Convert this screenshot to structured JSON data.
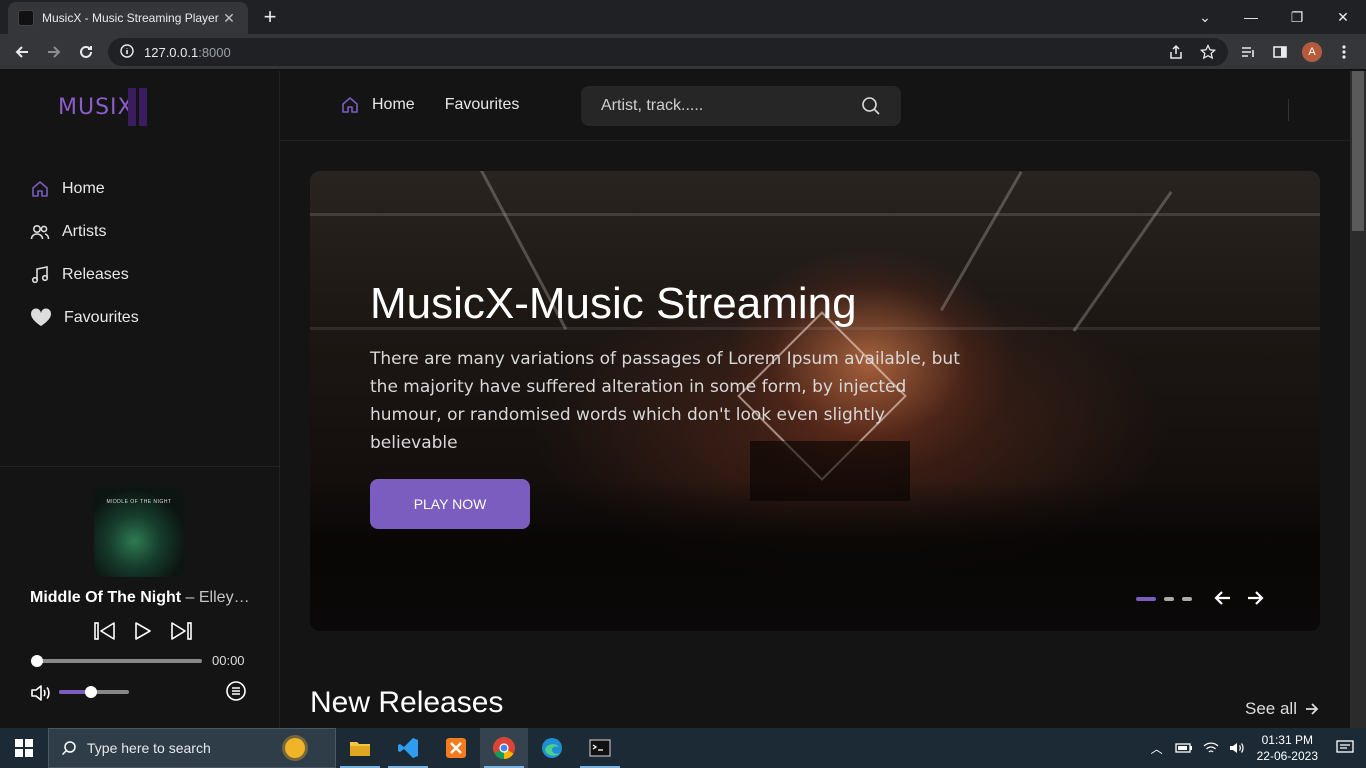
{
  "browser": {
    "tab_title": "MusicX - Music Streaming Player",
    "url_host": "127.0.0.1",
    "url_port": ":8000",
    "profile_initial": "A"
  },
  "app": {
    "logo": "MUSIX",
    "topnav": [
      {
        "label": "Home",
        "icon": "home-icon"
      },
      {
        "label": "Favourites"
      }
    ],
    "search_placeholder": "Artist, track.....",
    "sidebar": [
      {
        "label": "Home",
        "icon": "home-icon"
      },
      {
        "label": "Artists",
        "icon": "users-icon"
      },
      {
        "label": "Releases",
        "icon": "music-note-icon"
      },
      {
        "label": "Favourites",
        "icon": "heart-icon"
      }
    ],
    "player": {
      "cover_text": "MIDDLE OF THE NIGHT",
      "track_title": "Middle Of The Night",
      "track_artist": " – Elley…",
      "time": "00:00",
      "progress": 0,
      "volume": 0.45
    },
    "hero": {
      "title": "MusicX-Music Streaming",
      "text": "There are many variations of passages of Lorem Ipsum available, but the majority have suffered alteration in some form, by injected humour, or randomised words which don't look even slightly believable",
      "button": "PLAY NOW",
      "slides": 3,
      "active_slide": 0
    },
    "new_releases": {
      "title": "New Releases",
      "see_all": "See all"
    },
    "colors": {
      "accent": "#7b5cbf",
      "background": "#141414"
    }
  },
  "taskbar": {
    "search_placeholder": "Type here to search",
    "time": "01:31 PM",
    "date": "22-06-2023"
  }
}
